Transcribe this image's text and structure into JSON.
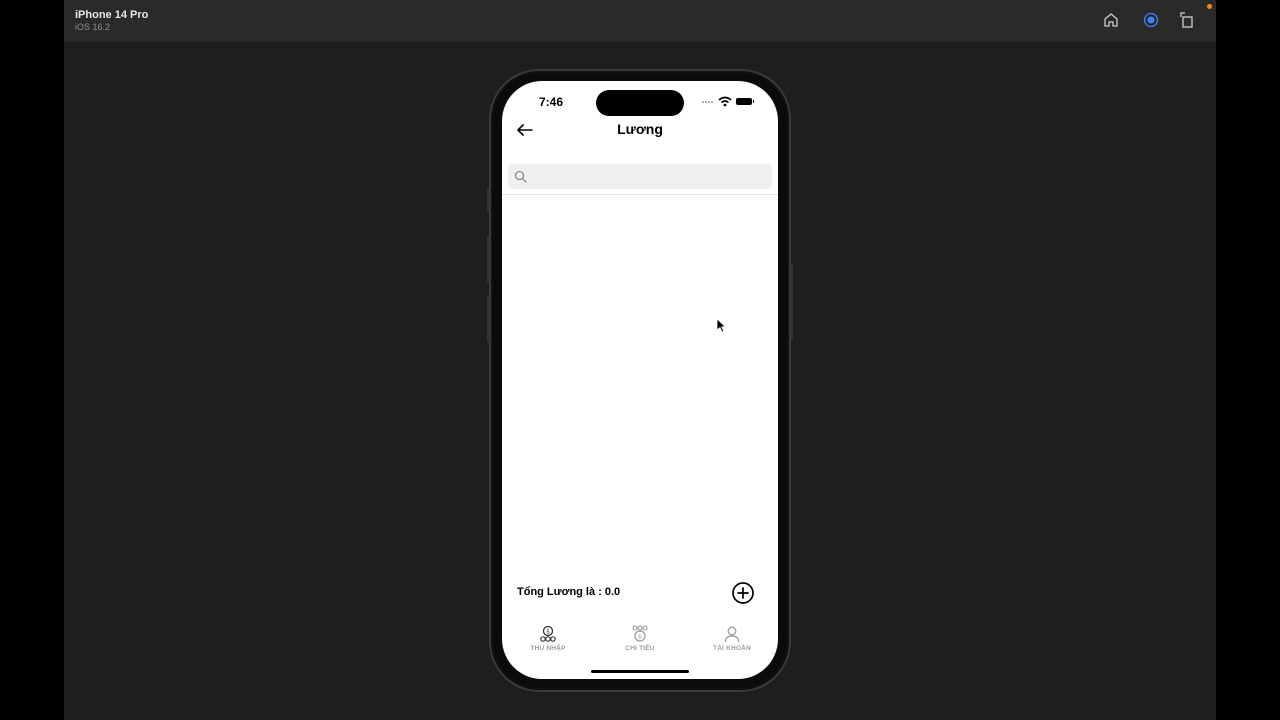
{
  "simulator": {
    "device_name": "iPhone 14 Pro",
    "os_version": "iOS 16.2",
    "toolbar_icons": [
      "home-icon",
      "screenshot-icon",
      "rotate-icon"
    ]
  },
  "status_bar": {
    "time": "7:46",
    "icons": [
      "signal-dots-icon",
      "wifi-icon",
      "battery-icon"
    ]
  },
  "nav": {
    "title": "Lương",
    "back_icon": "arrow-left-icon"
  },
  "search": {
    "placeholder": "",
    "value": ""
  },
  "footer": {
    "total_label": "Tổng Lương là : 0.0",
    "add_icon": "plus-circle-icon"
  },
  "tabbar": {
    "tabs": [
      {
        "label": "THU NHẬP",
        "icon": "income-icon"
      },
      {
        "label": "CHI TIÊU",
        "icon": "expense-icon"
      },
      {
        "label": "TÀI KHOẢN",
        "icon": "account-icon"
      }
    ]
  },
  "colors": {
    "simulator_bg": "#1e1e1e",
    "toolbar_bg": "#2a2a2a",
    "screen_bg": "#ffffff",
    "search_bg": "#efefef",
    "tab_label": "#9a9a9a",
    "accent_blue": "#3b82f6"
  }
}
